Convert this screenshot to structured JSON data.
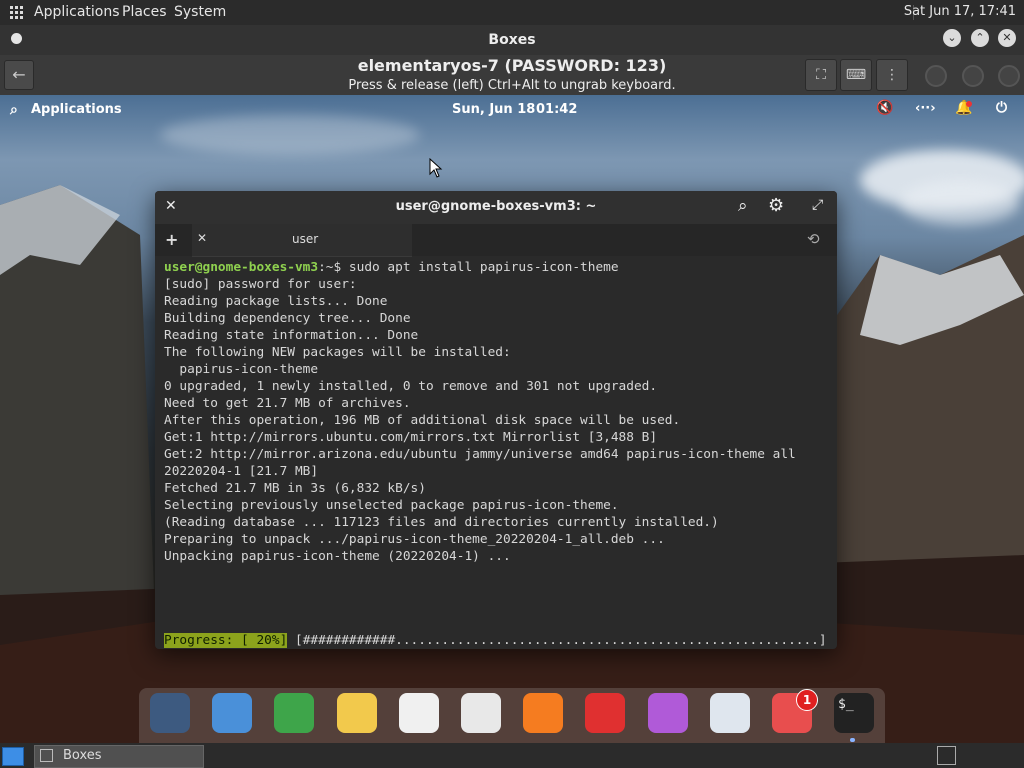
{
  "host_panel": {
    "menus": [
      "Applications",
      "Places",
      "System"
    ],
    "clock": "Sat Jun 17, 17:41"
  },
  "boxes_window": {
    "title": "Boxes",
    "vm_title": "elementaryos-7 (PASSWORD: 123)",
    "ungrab_hint": "Press & release (left) Ctrl+Alt to ungrab keyboard."
  },
  "guest_panel": {
    "applications_label": "Applications",
    "date": "Sun, Jun 18",
    "time": "01:42"
  },
  "terminal": {
    "title": "user@gnome-boxes-vm3: ~",
    "tab_label": "user",
    "prompt": "user@gnome-boxes-vm3",
    "prompt_suffix": ":~$ sudo apt install papirus-icon-theme",
    "lines": [
      "[sudo] password for user:",
      "Reading package lists... Done",
      "Building dependency tree... Done",
      "Reading state information... Done",
      "The following NEW packages will be installed:",
      "  papirus-icon-theme",
      "0 upgraded, 1 newly installed, 0 to remove and 301 not upgraded.",
      "Need to get 21.7 MB of archives.",
      "After this operation, 196 MB of additional disk space will be used.",
      "Get:1 http://mirrors.ubuntu.com/mirrors.txt Mirrorlist [3,488 B]",
      "Get:2 http://mirror.arizona.edu/ubuntu jammy/universe amd64 papirus-icon-theme all",
      "20220204-1 [21.7 MB]",
      "Fetched 21.7 MB in 3s (6,832 kB/s)",
      "Selecting previously unselected package papirus-icon-theme.",
      "(Reading database ... 117123 files and directories currently installed.)",
      "Preparing to unpack .../papirus-icon-theme_20220204-1_all.deb ...",
      "Unpacking papirus-icon-theme (20220204-1) ..."
    ],
    "progress_label": "Progress: [ 20%]",
    "progress_bar": " [############.......................................................]",
    "progress_fraction": 0.2
  },
  "dock": {
    "items": [
      {
        "name": "multitasking-view-icon",
        "color": "#3d5a80"
      },
      {
        "name": "files-icon",
        "color": "#4a90d9"
      },
      {
        "name": "web-browser-icon",
        "color": "#3ea54a"
      },
      {
        "name": "mail-icon",
        "color": "#f2c94c"
      },
      {
        "name": "tasks-icon",
        "color": "#f0f0f0"
      },
      {
        "name": "calendar-icon",
        "color": "#e8e8e8"
      },
      {
        "name": "music-icon",
        "color": "#f57c20"
      },
      {
        "name": "videos-icon",
        "color": "#e03030"
      },
      {
        "name": "photos-icon",
        "color": "#b05ad8"
      },
      {
        "name": "system-settings-icon",
        "color": "#dfe6ee"
      },
      {
        "name": "appcenter-icon",
        "color": "#e84e4e"
      },
      {
        "name": "terminal-icon",
        "color": "#222222"
      }
    ],
    "appcenter_badge": "1"
  },
  "taskbar": {
    "task_label": "Boxes"
  }
}
